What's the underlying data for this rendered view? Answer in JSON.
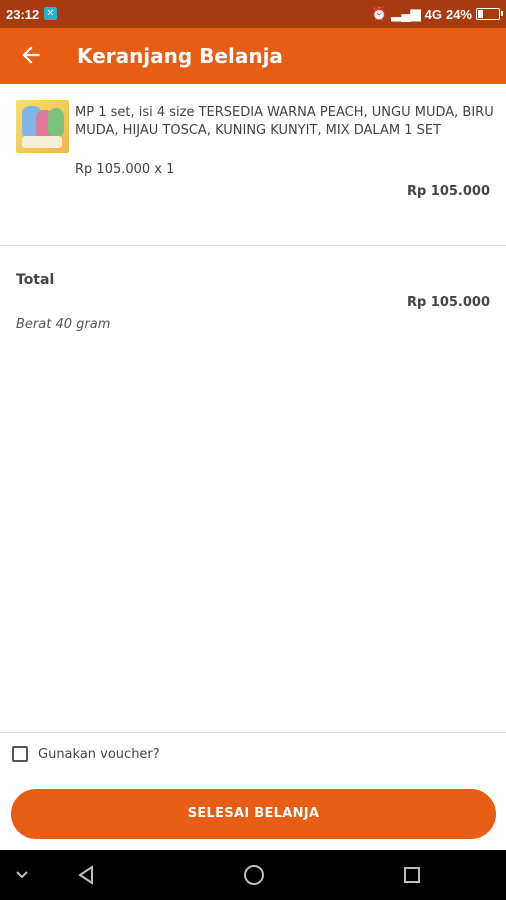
{
  "status_bar": {
    "time": "23:12",
    "notification_icon": "app-notification-icon",
    "signal_text": "4G",
    "battery_percent": "24%",
    "battery_level": 0.24
  },
  "app_bar": {
    "back_icon": "arrow-back-icon",
    "title": "Keranjang Belanja"
  },
  "cart_item": {
    "description": "MP 1 set, isi 4 size TERSEDIA WARNA PEACH, UNGU MUDA,  BIRU MUDA, HIJAU TOSCA, KUNING KUNYIT, MIX DALAM 1 SET",
    "price_qty": "Rp 105.000 x 1",
    "subtotal": "Rp 105.000"
  },
  "summary": {
    "total_label": "Total",
    "total_value": "Rp 105.000",
    "weight": "Berat 40 gram"
  },
  "voucher": {
    "label": "Gunakan voucher?",
    "checked": false
  },
  "actions": {
    "finish_label": "SELESAI BELANJA"
  },
  "colors": {
    "accent": "#e85d14",
    "status_bar": "#a83a10"
  },
  "nav_bar": {
    "icons": [
      "chevron-down-icon",
      "back-triangle-icon",
      "home-circle-icon",
      "recents-square-icon"
    ]
  }
}
